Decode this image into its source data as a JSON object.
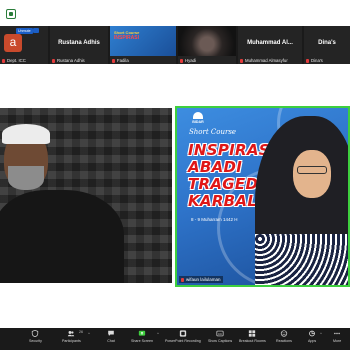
{
  "gallery": {
    "tiles": [
      {
        "name": "Dept. ICC",
        "display_name": "",
        "avatar_letter": "a",
        "badge": "Unmute"
      },
      {
        "name": "Rustana Adhis",
        "display_name": "Rustana Adhis"
      },
      {
        "name": "Fadila",
        "display_name": "",
        "type": "poster"
      },
      {
        "name": "Hyadi",
        "display_name": "",
        "type": "camera"
      },
      {
        "name": "Muhammad Almasyfur",
        "display_name": "Muhammad Al..."
      },
      {
        "name": "Dina's",
        "display_name": "Dina's"
      }
    ]
  },
  "share": {
    "logo_text": "BIDAR",
    "short_course": "Short Course",
    "title_lines": [
      "INSPIRASI",
      "ABADI",
      "TRAGEDI",
      "KARBALA"
    ],
    "dates": "8 - 9 Muharram 1442 H",
    "presenter_label": "wifaun lailulaman"
  },
  "toolbar": {
    "items": [
      {
        "label": "Security",
        "icon": "shield-icon"
      },
      {
        "label": "Participants",
        "icon": "participants-icon",
        "count": "26"
      },
      {
        "label": "Chat",
        "icon": "chat-icon"
      },
      {
        "label": "Share Screen",
        "icon": "share-screen-icon"
      },
      {
        "label": "PowerPoint Recording",
        "icon": "record-icon"
      },
      {
        "label": "Show Captions",
        "icon": "captions-icon"
      },
      {
        "label": "Breakout Rooms",
        "icon": "breakout-icon"
      },
      {
        "label": "Reactions",
        "icon": "reactions-icon"
      },
      {
        "label": "Apps",
        "icon": "apps-icon"
      },
      {
        "label": "More",
        "icon": "more-icon"
      }
    ]
  },
  "colors": {
    "share_border": "#3ecf3e",
    "share_screen": "#3ecf3e",
    "title_red": "#e01717"
  }
}
